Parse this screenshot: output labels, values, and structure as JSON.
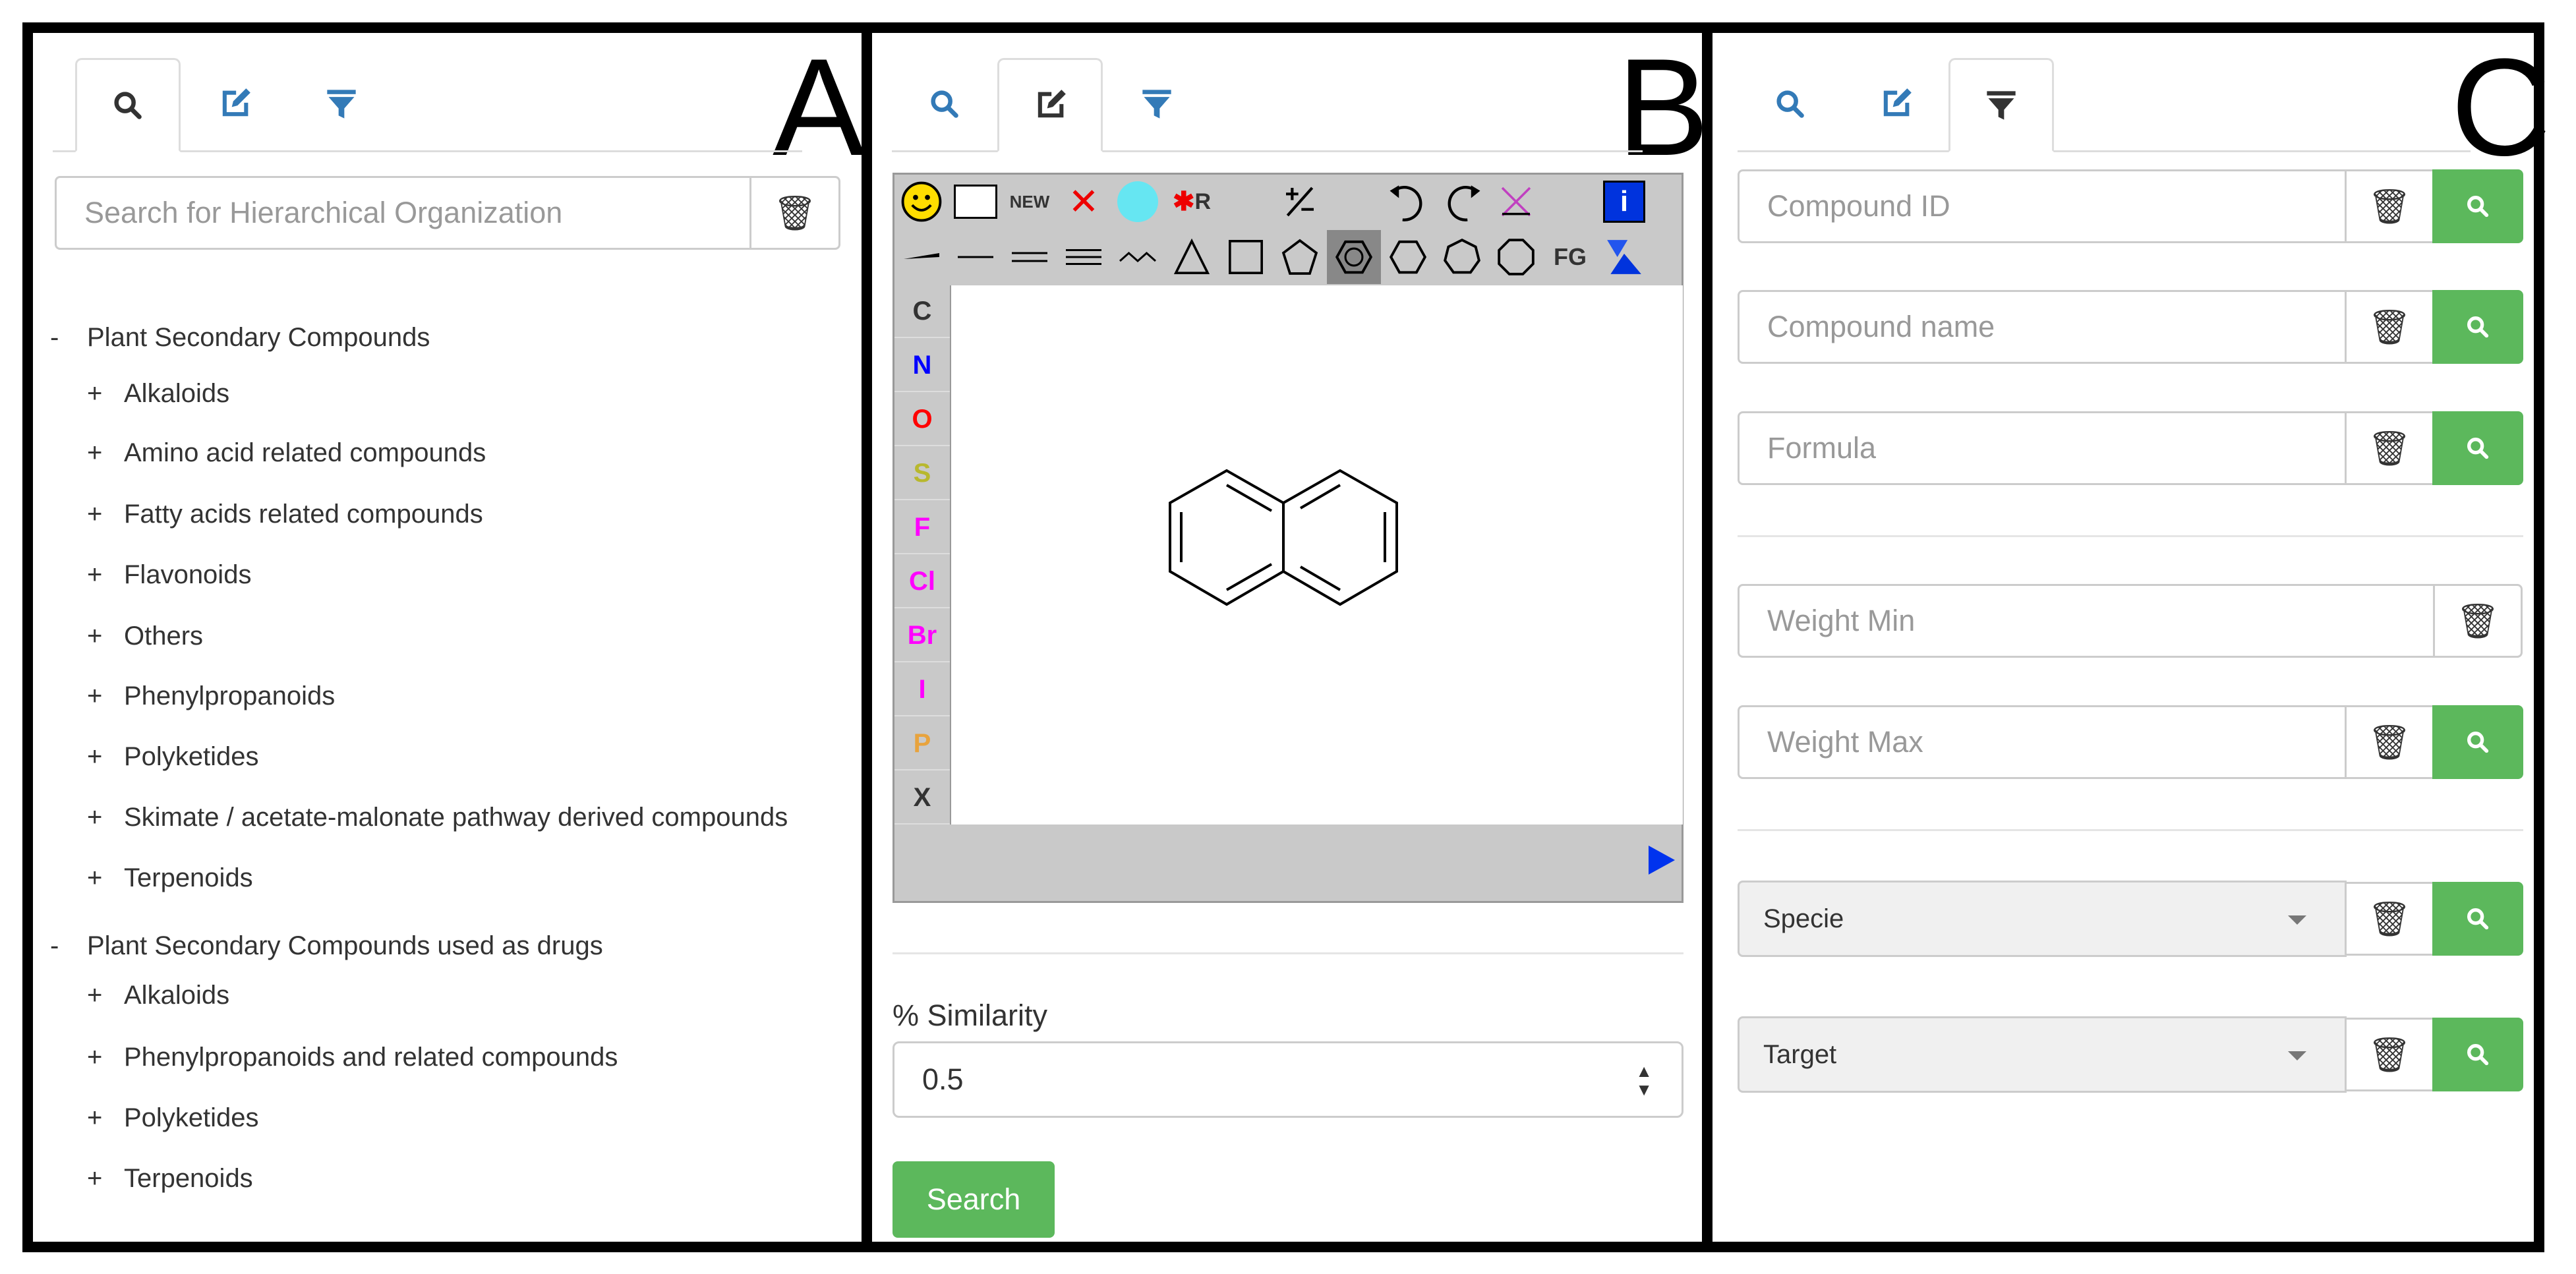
{
  "panels": {
    "a": {
      "letter": "A",
      "search_placeholder": "Search for Hierarchical Organization",
      "tree": [
        {
          "sign": "-",
          "label": "Plant Secondary Compounds",
          "level": 0
        },
        {
          "sign": "+",
          "label": "Alkaloids",
          "level": 1
        },
        {
          "sign": "+",
          "label": "Amino acid related compounds",
          "level": 1
        },
        {
          "sign": "+",
          "label": "Fatty acids related compounds",
          "level": 1
        },
        {
          "sign": "+",
          "label": "Flavonoids",
          "level": 1
        },
        {
          "sign": "+",
          "label": "Others",
          "level": 1
        },
        {
          "sign": "+",
          "label": "Phenylpropanoids",
          "level": 1
        },
        {
          "sign": "+",
          "label": "Polyketides",
          "level": 1
        },
        {
          "sign": "+",
          "label": "Skimate / acetate-malonate pathway derived compounds",
          "level": 1
        },
        {
          "sign": "+",
          "label": "Terpenoids",
          "level": 1
        },
        {
          "sign": "-",
          "label": "Plant Secondary Compounds used as drugs",
          "level": 0
        },
        {
          "sign": "+",
          "label": "Alkaloids",
          "level": 1
        },
        {
          "sign": "+",
          "label": "Phenylpropanoids and related compounds",
          "level": 1
        },
        {
          "sign": "+",
          "label": "Polyketides",
          "level": 1
        },
        {
          "sign": "+",
          "label": "Terpenoids",
          "level": 1
        }
      ]
    },
    "b": {
      "letter": "B",
      "toolbar": {
        "new_label": "NEW",
        "fg_label": "FG",
        "r_label": "R"
      },
      "atoms": [
        "C",
        "N",
        "O",
        "S",
        "F",
        "Cl",
        "Br",
        "I",
        "P",
        "X"
      ],
      "similarity_label": "% Similarity",
      "similarity_value": "0.5",
      "search_label": "Search"
    },
    "c": {
      "letter": "C",
      "compound_id_placeholder": "Compound ID",
      "compound_name_placeholder": "Compound name",
      "formula_placeholder": "Formula",
      "weight_min_placeholder": "Weight Min",
      "weight_max_placeholder": "Weight Max",
      "specie_label": "Specie",
      "target_label": "Target"
    }
  },
  "colors": {
    "accent_blue": "#337ab7",
    "search_green": "#5cb85c",
    "atom_colors": {
      "C": "#333333",
      "N": "#0000ff",
      "O": "#ff0000",
      "S": "#b8b82e",
      "F": "#ff00ff",
      "Cl": "#ff00ff",
      "Br": "#ff00ff",
      "I": "#ff00ff",
      "P": "#e8a33d",
      "X": "#333333"
    }
  }
}
